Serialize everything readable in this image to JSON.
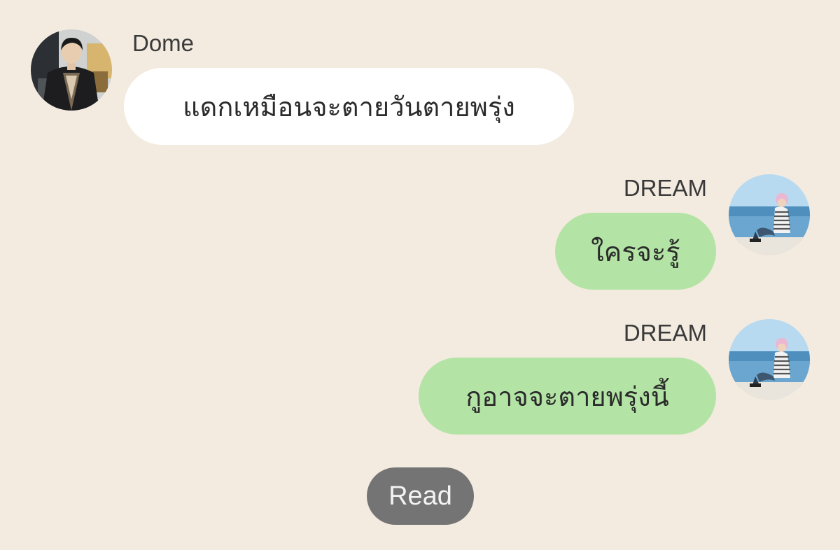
{
  "messages": [
    {
      "sender": "Dome",
      "direction": "incoming",
      "text": "แดกเหมือนจะตายวันตายพรุ่ง",
      "avatar_icon": "dome-avatar-photo"
    },
    {
      "sender": "DREAM",
      "direction": "outgoing",
      "text": "ใครจะรู้",
      "avatar_icon": "dream-avatar-photo"
    },
    {
      "sender": "DREAM",
      "direction": "outgoing",
      "text": "กูอาจจะตายพรุ่งนี้",
      "avatar_icon": "dream-avatar-photo"
    }
  ],
  "read_receipt": {
    "label": "Read"
  },
  "colors": {
    "background": "#f3ebe0",
    "incoming_bubble": "#ffffff",
    "outgoing_bubble": "#b3e3a5",
    "read_pill": "#747474"
  }
}
